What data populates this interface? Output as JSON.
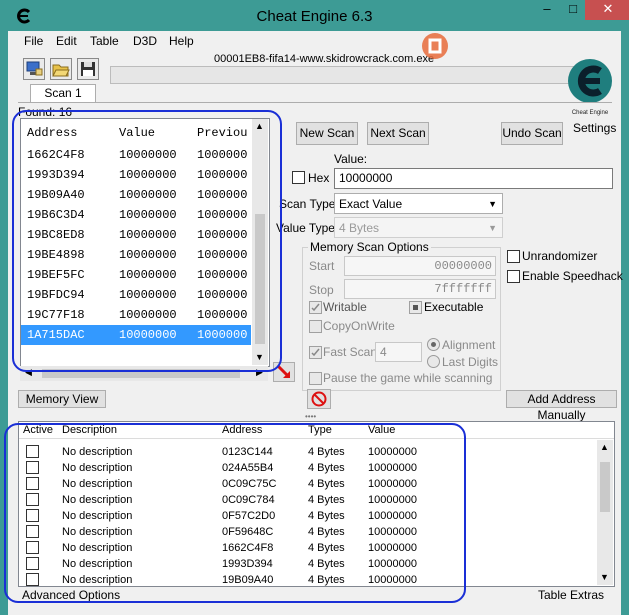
{
  "window": {
    "title": "Cheat Engine 6.3",
    "buttons": {
      "minimize": "–",
      "maximize": "□",
      "close": "✕"
    }
  },
  "menu": [
    "File",
    "Edit",
    "Table",
    "D3D",
    "Help"
  ],
  "process_name": "00001EB8-fifa14-www.skidrowcrack.com.exe",
  "tab_label": "Scan 1",
  "found_text": "Found: 16",
  "results": {
    "headers": {
      "address": "Address",
      "value": "Value",
      "previous": "Previou"
    },
    "rows": [
      {
        "address": "1662C4F8",
        "value": "10000000",
        "previous": "1000000"
      },
      {
        "address": "1993D394",
        "value": "10000000",
        "previous": "1000000"
      },
      {
        "address": "19B09A40",
        "value": "10000000",
        "previous": "1000000"
      },
      {
        "address": "19B6C3D4",
        "value": "10000000",
        "previous": "1000000"
      },
      {
        "address": "19BC8ED8",
        "value": "10000000",
        "previous": "1000000"
      },
      {
        "address": "19BE4898",
        "value": "10000000",
        "previous": "1000000"
      },
      {
        "address": "19BEF5FC",
        "value": "10000000",
        "previous": "1000000"
      },
      {
        "address": "19BFDC94",
        "value": "10000000",
        "previous": "1000000"
      },
      {
        "address": "19C77F18",
        "value": "10000000",
        "previous": "1000000"
      },
      {
        "address": "1A715DAC",
        "value": "10000000",
        "previous": "1000000",
        "selected": true
      }
    ]
  },
  "scan_buttons": {
    "new_scan": "New Scan",
    "next_scan": "Next Scan",
    "undo_scan": "Undo Scan"
  },
  "settings_label": "Settings",
  "logo_caption": "Cheat Engine",
  "value_label": "Value:",
  "hex_label": "Hex",
  "value_input": "10000000",
  "scan_type_label": "Scan Type",
  "scan_type_value": "Exact Value",
  "value_type_label": "Value Type",
  "value_type_value": "4 Bytes",
  "memory_scan": {
    "title": "Memory Scan Options",
    "start_label": "Start",
    "start_value": "00000000",
    "stop_label": "Stop",
    "stop_value": "7fffffff",
    "writable": "Writable",
    "executable": "Executable",
    "copy_on_write": "CopyOnWrite",
    "fast_scan": "Fast Scan",
    "fast_scan_value": "4",
    "alignment": "Alignment",
    "last_digits": "Last Digits",
    "pause_game": "Pause the game while scanning"
  },
  "unrandomizer": "Unrandomizer",
  "enable_speedhack": "Enable Speedhack",
  "memory_view_button": "Memory View",
  "add_address_button": "Add Address Manually",
  "table": {
    "headers": {
      "active": "Active",
      "description": "Description",
      "address": "Address",
      "type": "Type",
      "value": "Value"
    },
    "rows": [
      {
        "description": "No description",
        "address": "0123C144",
        "type": "4 Bytes",
        "value": "10000000"
      },
      {
        "description": "No description",
        "address": "024A55B4",
        "type": "4 Bytes",
        "value": "10000000"
      },
      {
        "description": "No description",
        "address": "0C09C75C",
        "type": "4 Bytes",
        "value": "10000000"
      },
      {
        "description": "No description",
        "address": "0C09C784",
        "type": "4 Bytes",
        "value": "10000000"
      },
      {
        "description": "No description",
        "address": "0F57C2D0",
        "type": "4 Bytes",
        "value": "10000000"
      },
      {
        "description": "No description",
        "address": "0F59648C",
        "type": "4 Bytes",
        "value": "10000000"
      },
      {
        "description": "No description",
        "address": "1662C4F8",
        "type": "4 Bytes",
        "value": "10000000"
      },
      {
        "description": "No description",
        "address": "1993D394",
        "type": "4 Bytes",
        "value": "10000000"
      },
      {
        "description": "No description",
        "address": "19B09A40",
        "type": "4 Bytes",
        "value": "10000000"
      }
    ]
  },
  "advanced_options": "Advanced Options",
  "table_extras": "Table Extras",
  "colors": {
    "title_bar": "#3d9b95",
    "selection": "#3399ff",
    "annotation": "#1a2fd6",
    "close_button": "#c75050"
  }
}
